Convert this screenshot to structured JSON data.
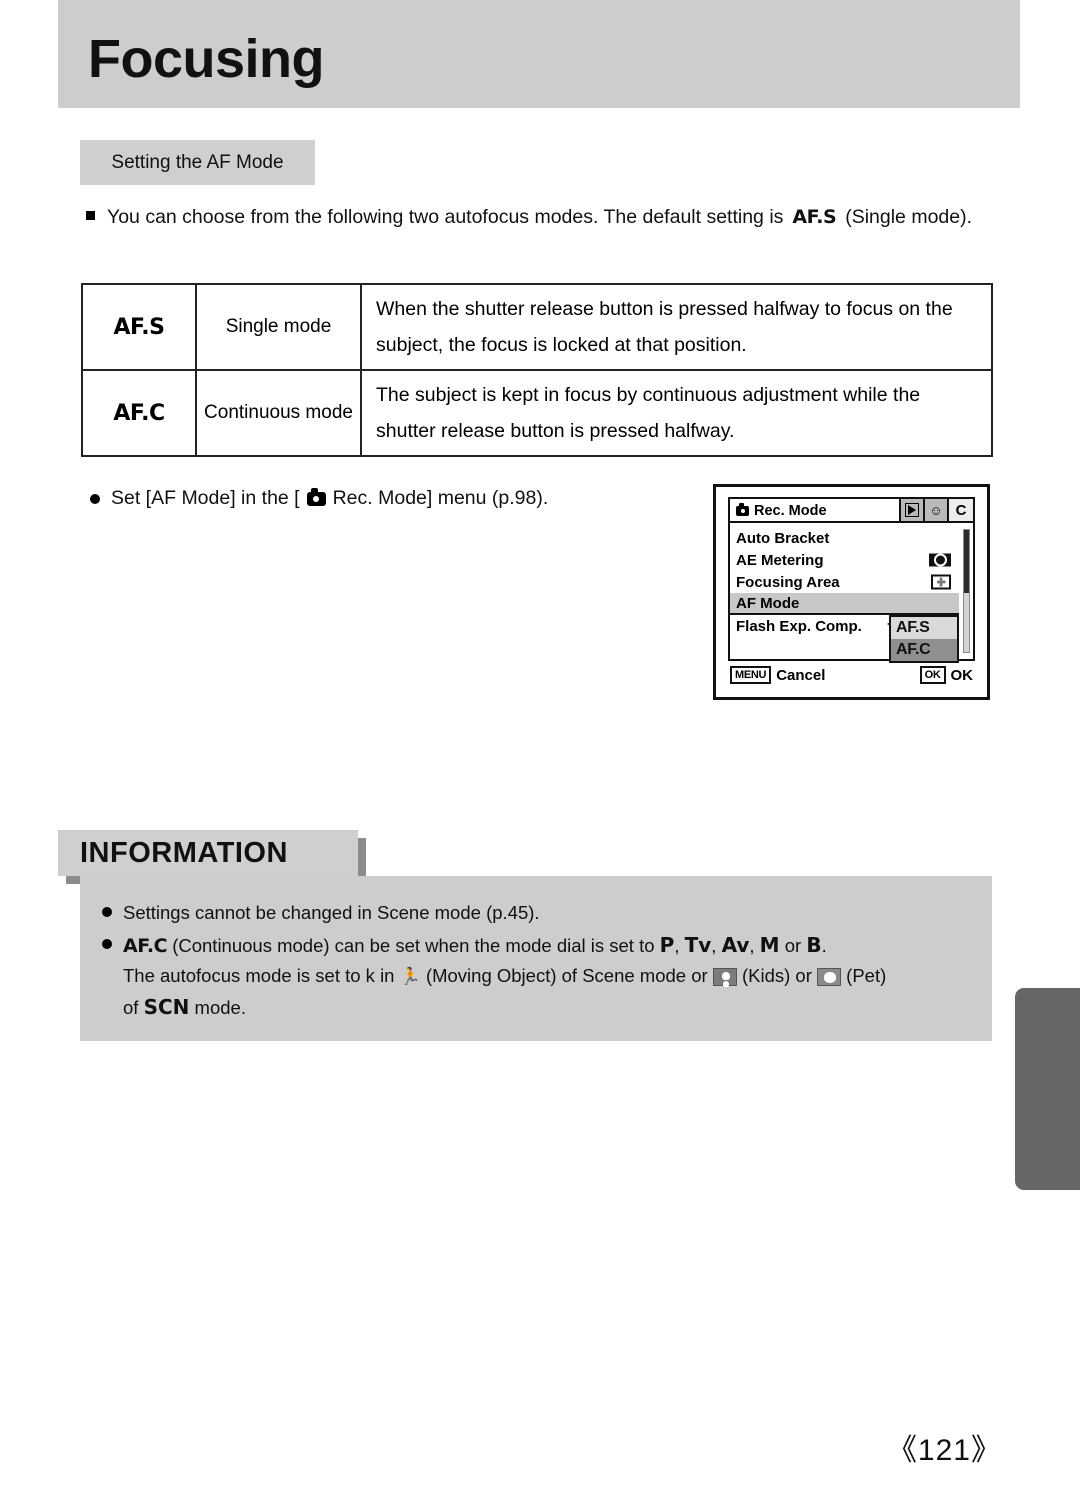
{
  "header": {
    "title": "Focusing"
  },
  "section": {
    "label": "Setting the AF Mode"
  },
  "intro": {
    "bullet_icon": "square-bullet",
    "text_before": "You can choose from the following two autofocus modes. The default setting is",
    "mode_glyph": "AF.S",
    "text_after": "(Single mode)."
  },
  "mode_table": {
    "rows": [
      {
        "code": "AF.S",
        "name": "Single mode",
        "description": "When the shutter release button is pressed halfway to focus on the subject, the focus is locked at that position."
      },
      {
        "code": "AF.C",
        "name": "Continuous mode",
        "description": "The subject is kept in focus by continuous adjustment while the shutter release button is pressed halfway."
      }
    ]
  },
  "menu_reference": {
    "bullet_icon": "round-bullet",
    "text_before": "Set [AF Mode] in the [",
    "camera_icon": "camera-icon",
    "text_after": "Rec. Mode] menu (p.98)."
  },
  "lcd_menu": {
    "title": "Rec. Mode",
    "title_icon": "camera-icon",
    "tabs": [
      {
        "name": "playback-tab",
        "glyph": "play-icon"
      },
      {
        "name": "setup-tab",
        "glyph": "tools-icon"
      },
      {
        "name": "custom-tab",
        "glyph": "C"
      }
    ],
    "items": [
      {
        "label": "Auto Bracket",
        "value_icon": "",
        "highlighted": false
      },
      {
        "label": "AE Metering",
        "value_icon": "ae-metering-icon",
        "highlighted": false
      },
      {
        "label": "Focusing Area",
        "value_icon": "focusing-area-icon",
        "highlighted": false
      },
      {
        "label": "AF Mode",
        "value_icon": "",
        "highlighted": true
      },
      {
        "label": "Flash Exp. Comp.",
        "value_icon": "",
        "highlighted": false
      }
    ],
    "dropdown": {
      "options": [
        {
          "label": "AF.S",
          "selected": false
        },
        {
          "label": "AF.C",
          "selected": true
        }
      ]
    },
    "footer": {
      "cancel_key": "MENU",
      "cancel_label": "Cancel",
      "ok_key": "OK",
      "ok_label": "OK"
    }
  },
  "information": {
    "heading": "INFORMATION",
    "items": [
      {
        "plain": "Settings cannot be changed in Scene mode (p.45)."
      },
      {
        "mode_glyph": "AF.C",
        "part1": "(Continuous mode) can be set when the mode dial is set to",
        "dials": [
          "P",
          "Tv",
          "Av",
          "M",
          "B"
        ],
        "part2": "The autofocus mode is set to k in",
        "moving_object_icon": "running-person-icon",
        "part3": "(Moving Object) of Scene mode or",
        "kids_icon": "kids-icon",
        "part4": "(Kids) or",
        "pet_icon": "pet-icon",
        "part5": "(Pet)",
        "part6": "of",
        "scn_glyph": "SCN",
        "part7": "mode."
      }
    ]
  },
  "page_number": "《121》",
  "colors": {
    "header_band": "#cdcdcd",
    "section_label": "#cfcfcf",
    "info_box": "#cdcdcd",
    "info_shadow": "#8c8c8c",
    "side_tab": "#666666",
    "menu_highlight": "#c8c8c8",
    "dropdown_selected": "#8f8f8f",
    "dropdown_unselected": "#dadada"
  }
}
